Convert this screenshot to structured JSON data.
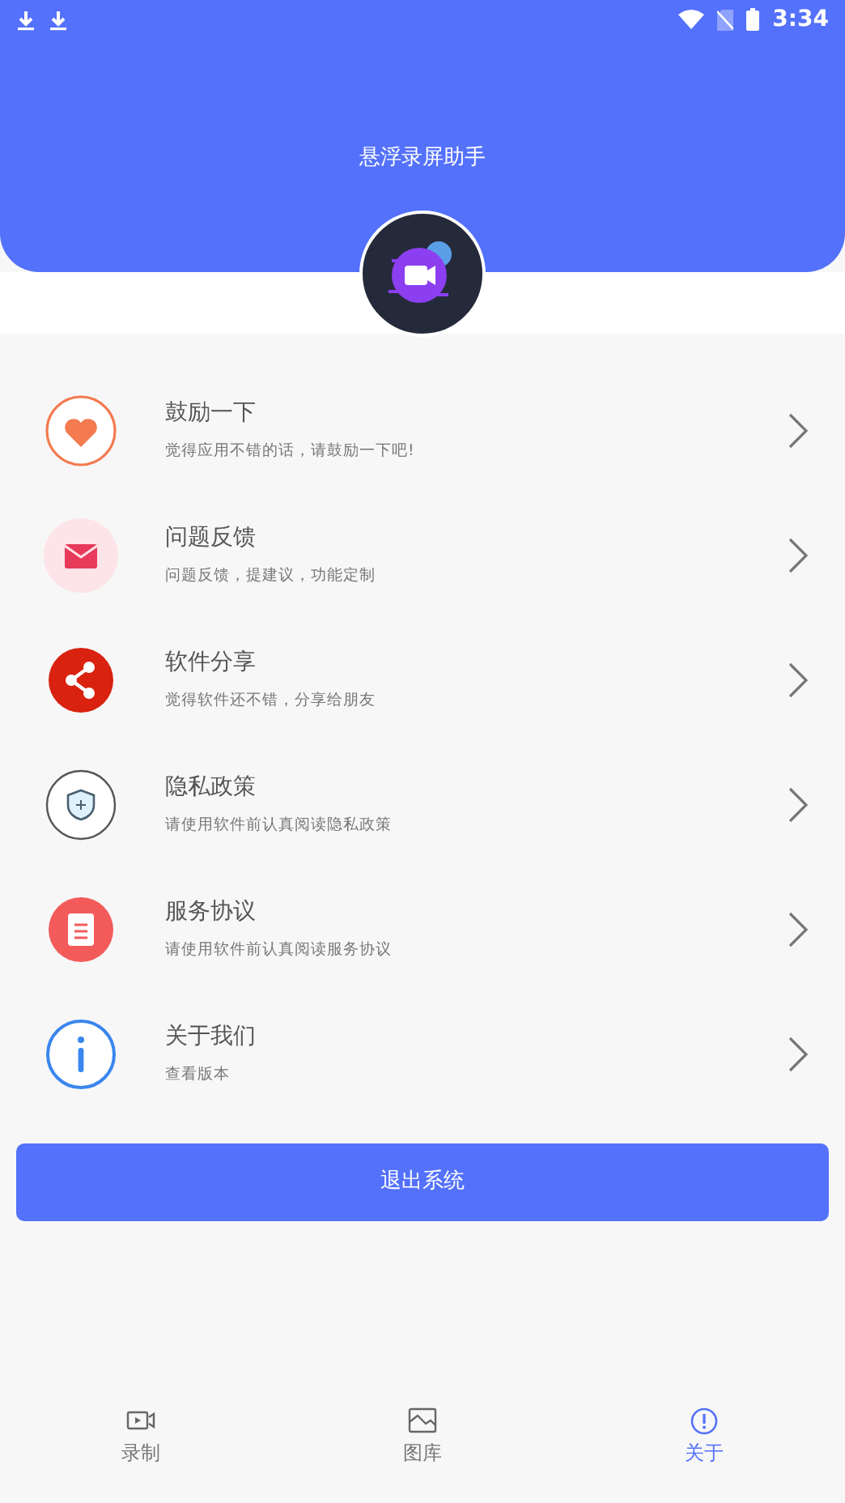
{
  "status_bar": {
    "time": "3:34"
  },
  "header": {
    "title": "悬浮录屏助手"
  },
  "menu": [
    {
      "kind": "heart",
      "title": "鼓励一下",
      "subtitle": "觉得应用不错的话，请鼓励一下吧!"
    },
    {
      "kind": "mail",
      "title": "问题反馈",
      "subtitle": "问题反馈，提建议，功能定制"
    },
    {
      "kind": "share",
      "title": "软件分享",
      "subtitle": "觉得软件还不错，分享给朋友"
    },
    {
      "kind": "shield",
      "title": "隐私政策",
      "subtitle": "请使用软件前认真阅读隐私政策"
    },
    {
      "kind": "doc",
      "title": "服务协议",
      "subtitle": "请使用软件前认真阅读服务协议"
    },
    {
      "kind": "info",
      "title": "关于我们",
      "subtitle": "查看版本"
    }
  ],
  "logout_button": "退出系统",
  "tabs": [
    {
      "kind": "record",
      "label": "录制",
      "selected": false
    },
    {
      "kind": "gallery",
      "label": "图库",
      "selected": false
    },
    {
      "kind": "about",
      "label": "关于",
      "selected": true
    }
  ]
}
